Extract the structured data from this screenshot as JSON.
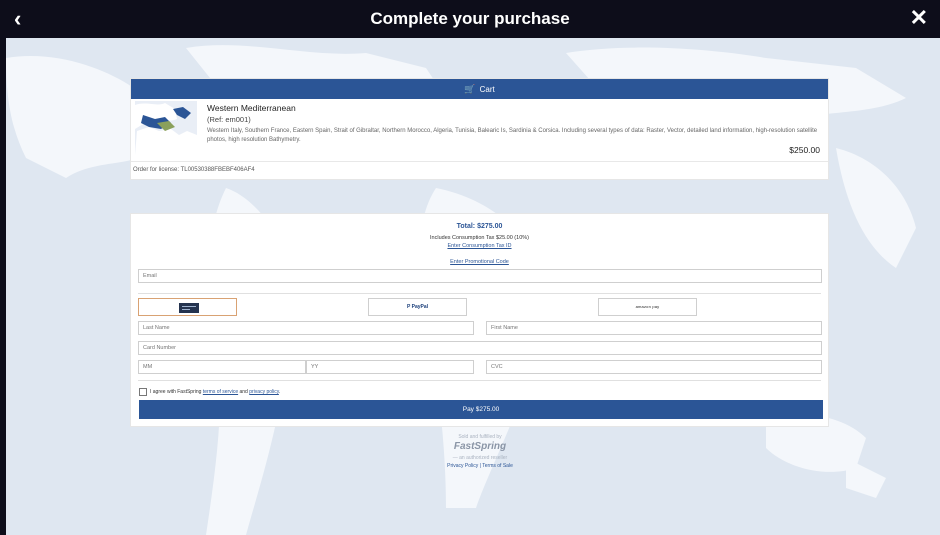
{
  "titlebar": {
    "title": "Complete your purchase",
    "back_icon": "‹",
    "close_icon": "✕"
  },
  "cart": {
    "header_label": "Cart",
    "header_icon": "🛒",
    "item": {
      "name": "Western Mediterranean",
      "ref": "(Ref: em001)",
      "description": "Western Italy, Southern France, Eastern Spain, Strait of Gibraltar, Northern Morocco, Algeria, Tunisia, Balearic Is, Sardinia & Corsica. Including several types of data: Raster, Vector, detailed land information, high-resolution satellite photos, high resolution Bathymetry.",
      "price": "$250.00"
    },
    "license": "Order for license: TL00530388FBEBF406AF4"
  },
  "payment": {
    "total": "Total: $275.00",
    "tax_note": "Includes Consumption Tax $25.00 (10%)",
    "tax_id_link": "Enter Consumption Tax ID",
    "promo_link": "Enter Promotional Code",
    "email_placeholder": "Email",
    "methods": {
      "paypal": "P PayPal",
      "amazon": "amazon pay"
    },
    "last_name_placeholder": "Last Name",
    "first_name_placeholder": "First Name",
    "card_number_placeholder": "Card Number",
    "mm_placeholder": "MM",
    "yy_placeholder": "YY",
    "cvc_placeholder": "CVC",
    "agree_prefix": "I agree with FastSpring",
    "terms_link": "terms of service",
    "agree_and": "and",
    "privacy_link": "privacy policy",
    "agree_suffix": ".",
    "pay_button": "Pay $275.00"
  },
  "footer": {
    "sold_by": "Sold and fulfilled by",
    "brand": "FastSpring",
    "reseller": "— an authorized reseller",
    "privacy": "Privacy Policy",
    "divider": "|",
    "terms": "Terms of Sale"
  },
  "colors": {
    "brand_blue": "#2b5596",
    "titlebar": "#0d0d1a",
    "selected_method": "#d9a273"
  }
}
